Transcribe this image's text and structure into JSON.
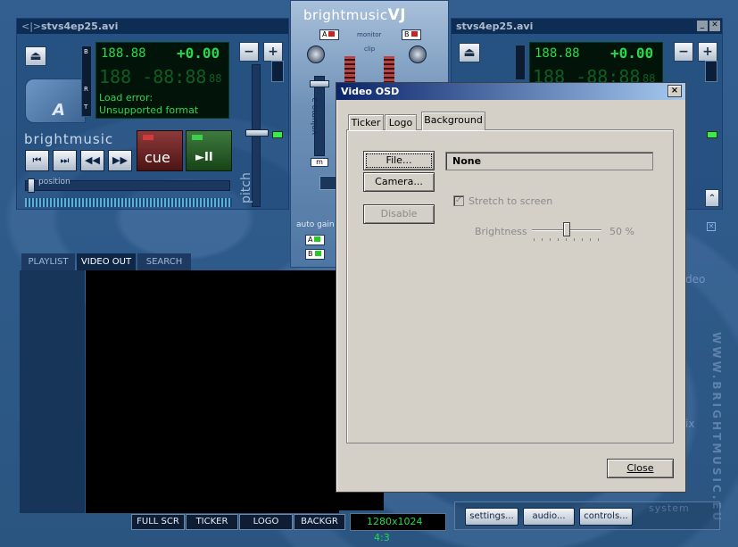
{
  "left_deck": {
    "title": "stvs4ep25.avi",
    "deck_letter": "A",
    "lcd_time_small": "188.88",
    "lcd_pitch": "+0.00",
    "lcd_time_big": "188 -88:88",
    "lcd_frames": "88",
    "status_line1": "Load error:",
    "status_line2": "Unsupported format",
    "brand": "brightmusic",
    "cue_label": "cue",
    "play_label": "►II",
    "position_label": "position",
    "pitch_label": "pitch",
    "minus_label": "−",
    "plus_label": "+"
  },
  "right_deck": {
    "title": "stvs4ep25.avi",
    "lcd_time_small": "188.88",
    "lcd_pitch": "+0.00",
    "lcd_time_big": "188 -88:88",
    "lcd_frames": "88",
    "minus_label": "−",
    "plus_label": "+"
  },
  "center": {
    "logo_light": "brightmusic",
    "logo_bold": "VJ",
    "monitor_label": "monitor",
    "clip_label": "clip",
    "volume_label": "volume a",
    "auto_gain_label": "auto gain",
    "m_label": "m",
    "a_label": "A",
    "b_label": "B"
  },
  "tabs": [
    "PLAYLIST",
    "VIDEO OUT",
    "SEARCH"
  ],
  "bottom_bar": {
    "full_scr": "FULL SCR",
    "ticker": "TICKER",
    "logo": "LOGO",
    "backgr": "BACKGR",
    "resolution": "1280x1024",
    "aspect": "4:3"
  },
  "right_panel": {
    "settings": "settings...",
    "audio": "audio...",
    "controls": "controls...",
    "system_label": "system",
    "website_vertical": "WWW.BRIGHTMUSIC.EU",
    "video_label": "deo",
    "mix_label": "ix"
  },
  "dialog": {
    "title": "Video OSD",
    "close_x": "×",
    "tabs": [
      "Ticker",
      "Logo",
      "Background"
    ],
    "active_tab": "Background",
    "file_button": "File...",
    "camera_button": "Camera...",
    "disable_button": "Disable",
    "source_value": "None",
    "stretch_label": "Stretch to screen",
    "brightness_label": "Brightness",
    "brightness_value": "50 %",
    "brightness_level": 0.5,
    "close_button": "Close"
  }
}
